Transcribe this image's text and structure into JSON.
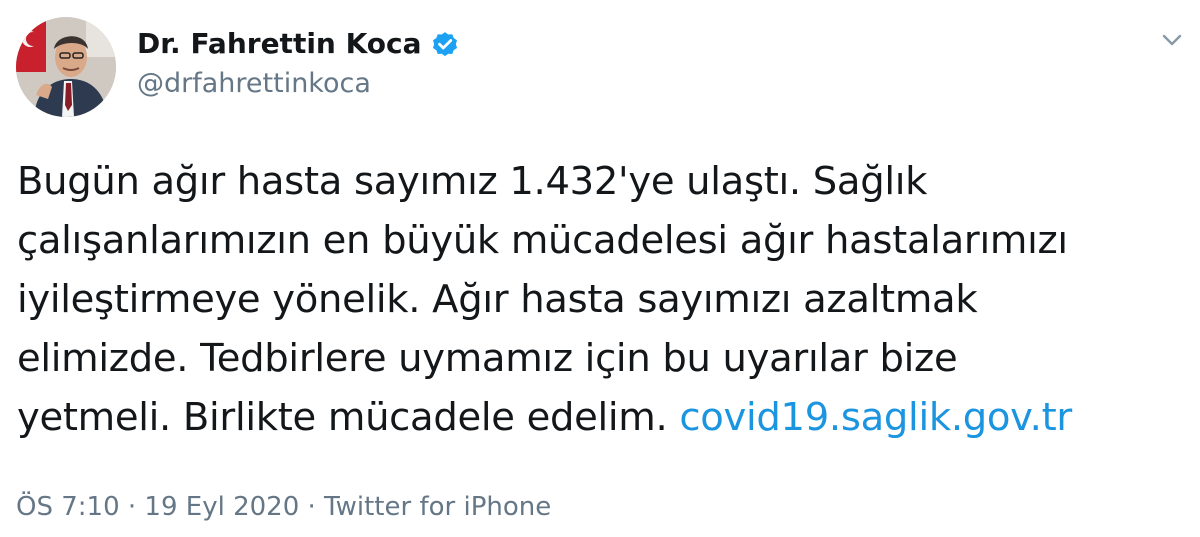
{
  "author": {
    "display_name": "Dr. Fahrettin Koca",
    "handle": "@drfahrettinkoca",
    "verified": true,
    "avatar_icon": "profile-photo"
  },
  "tweet": {
    "lines": [
      "Bugün ağır hasta sayımız 1.432'ye ulaştı. Sağlık",
      "çalışanlarımızın en büyük mücadelesi ağır hastalarımızı",
      "iyileştirmeye yönelik. Ağır hasta sayımızı azaltmak",
      "elimizde. Tedbirlere uymamız için bu uyarılar bize",
      "yetmeli. Birlikte mücadele edelim."
    ],
    "link_text": "covid19.saglik.gov.tr"
  },
  "meta": {
    "time": "ÖS 7:10",
    "separator": "·",
    "date": "19 Eyl 2020",
    "source": "Twitter for iPhone"
  },
  "colors": {
    "text": "#14171a",
    "secondary": "#657786",
    "link": "#1b95e0",
    "verified": "#1da1f2"
  },
  "icons": {
    "menu": "chevron-down-icon",
    "verified": "verified-badge-icon"
  }
}
